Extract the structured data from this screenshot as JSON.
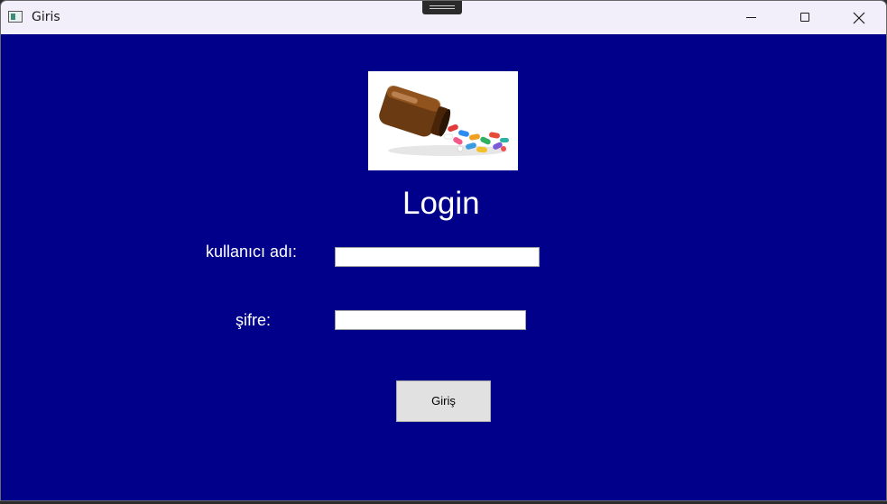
{
  "window": {
    "title": "Giris",
    "icons": {
      "app": "window-app-icon",
      "minimize": "minimize-icon",
      "maximize": "maximize-icon",
      "close": "close-icon"
    }
  },
  "form": {
    "image": "pill-bottle-image",
    "heading": "Login",
    "username_label": "kullanıcı adı:",
    "username_value": "",
    "password_label": "şifre:",
    "password_value": "",
    "submit_label": "Giriş"
  },
  "colors": {
    "background": "#00008b",
    "titlebar": "#f3effa",
    "text": "#ffffff",
    "button": "#e1e1e1"
  }
}
